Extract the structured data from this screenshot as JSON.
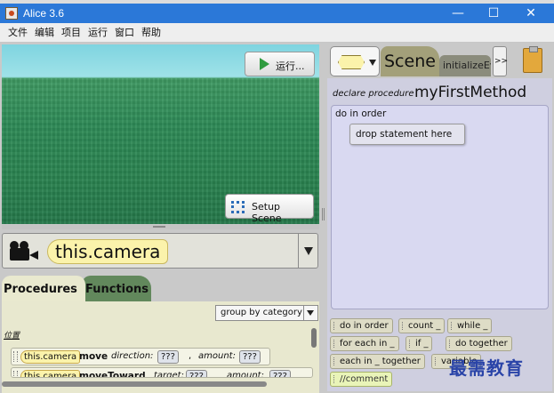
{
  "window": {
    "title": "Alice 3.6",
    "minimize": "—",
    "maximize": "☐",
    "close": "✕"
  },
  "menu": [
    "文件",
    "编辑",
    "项目",
    "运行",
    "窗口",
    "帮助"
  ],
  "scene_view": {
    "run_label": "运行...",
    "setup_label": "Setup Scene"
  },
  "selector": {
    "label": "this.camera"
  },
  "tabs": {
    "procedures": "Procedures",
    "functions": "Functions"
  },
  "group": {
    "selected": "group by category"
  },
  "category": "位置",
  "methods": [
    {
      "object": "this.camera",
      "name": "move",
      "param1": "direction:",
      "value1": "???",
      "sep": ",",
      "param2": "amount:",
      "value2": "???"
    },
    {
      "object": "this.camera",
      "name": "moveToward",
      "param1": "target:",
      "value1": "???",
      "param2": "amount:",
      "value2": "???"
    }
  ],
  "editor": {
    "type_icon": "hexagon-type-icon",
    "scene_tab": "Scene",
    "init_tab": "initializeEventListeners",
    "more": ">>",
    "declare": "declare procedure",
    "method_name": "myFirstMethod",
    "do_in_order": "do in order",
    "drop_hint": "drop statement here"
  },
  "statements": [
    "do in order",
    "count _",
    "while _",
    "for each in _",
    "if _",
    "do together",
    "each in _ together",
    "variable",
    "//comment"
  ],
  "watermark": "最需教育",
  "colors": {
    "titlebar": "#2b78d8",
    "object_pill": "#fbf3ab",
    "functions_tab": "#62885c",
    "editor_bg": "#cfcfe0"
  }
}
